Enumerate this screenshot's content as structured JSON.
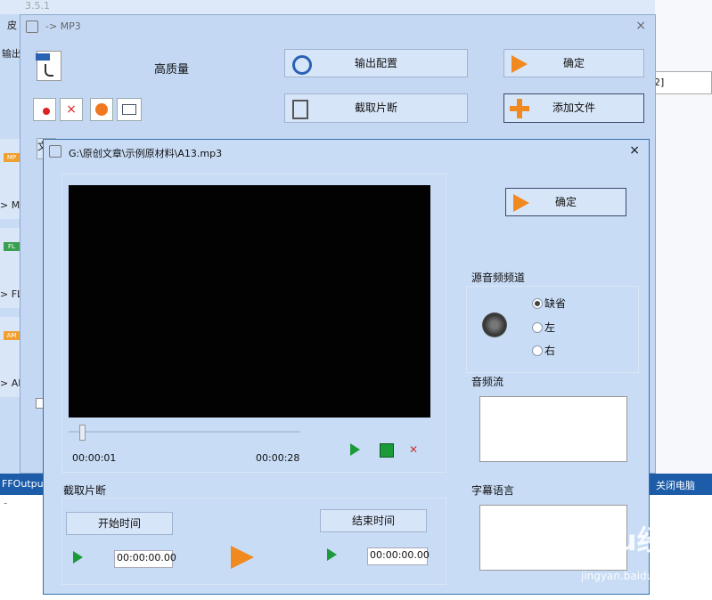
{
  "main_window": {
    "version": "3.5.1",
    "left_labels": [
      "皮",
      "输出"
    ],
    "formats": [
      {
        "badge": "MP",
        "label": "> MP",
        "color": "#f0a030"
      },
      {
        "badge": "FL",
        "label": "> FLA",
        "color": "#3aa050"
      },
      {
        "badge": "AM",
        "label": "> AM",
        "color": "#f0a030"
      }
    ],
    "right_input_value": "2]",
    "status_left": "FFOutput",
    "status_right": "关闭电脑",
    "bottom_text": "-"
  },
  "mp3_dialog": {
    "title": "-> MP3",
    "quality": "高质量",
    "output_config": "输出配置",
    "ok": "确定",
    "clip": "截取片断",
    "add_file": "添加文件",
    "list_header": "文"
  },
  "clip_dialog": {
    "title": "G:\\原创文章\\示例原材料\\A13.mp3",
    "ok": "确定",
    "current_time": "00:00:01",
    "total_time": "00:00:28",
    "source_channel_label": "源音频频道",
    "channel_options": [
      "缺省",
      "左",
      "右"
    ],
    "selected_channel": "缺省",
    "audio_stream_label": "音频流",
    "subtitle_label": "字幕语言",
    "clip_label": "截取片断",
    "start_time_label": "开始时间",
    "start_time_value": "00:00:00.00",
    "end_time_label": "结束时间",
    "end_time_value": "00:00:00.00"
  },
  "watermark": {
    "logo": "Baidu经验",
    "url": "jingyan.baidu.com"
  }
}
